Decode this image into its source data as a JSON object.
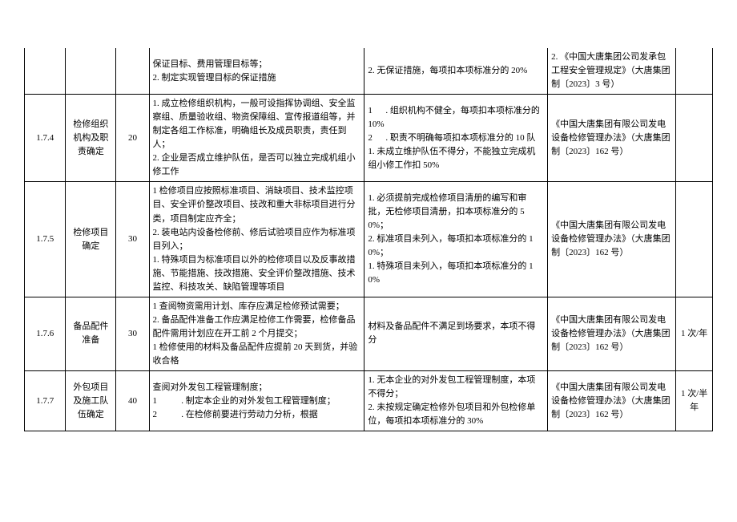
{
  "rows": [
    {
      "id": "",
      "name": "",
      "score": "",
      "content": "保证目标、费用管理目标等；\n2. 制定实现管理目标的保证措施",
      "rule": "2. 无保证措施，每项扣本项标准分的 20%",
      "ref": "2. 《中国大唐集团公司发承包工程安全管理规定》（大唐集团制〔2023〕3 号）",
      "freq": ""
    },
    {
      "id": "1.7.4",
      "name": "检修组织机构及职责确定",
      "score": "20",
      "content": "1. 成立检修组织机构，一般可设指挥协调组、安全监察组、质量验收组、物资保障组、宣传报道组等，并制定各组工作标准，明确组长及成员职责，责任到人；\n2. 企业是否成立维护队伍，是否可以独立完成机组小修工作",
      "rule": "1      . 组织机构不健全，每项扣本项标准分的 10%\n2      . 职责不明确每项扣本项标准分的 10 队\n1. 未成立维护队伍不得分，不能独立完成机组小修工作扣 50%",
      "ref": "《中国大唐集团有限公司发电设备检修管理办法》（大唐集团制〔2023〕162 号）",
      "freq": ""
    },
    {
      "id": "1.7.5",
      "name": "检修项目确定",
      "score": "30",
      "content": "1 检修项目应按照标准项目、消缺项目、技术监控项目、安全评价整改项目、技改和重大非标项目进行分类，项目制定应齐全；\n2. 装电站内设备检修前、修后试验项目应作为标准项目列入；\n1. 特殊项目为标准项目以外的检修项目以及反事故措施、节能措施、技改措施、安全评价整改措施、技术监控、科技攻关、缺陷管理等项目",
      "rule": "1. 必须提前完成检修项目清册的编写和审批，无检修项目清册，扣本项标准分的 50%；\n2. 标准项目未列入，每项扣本项标准分的 10%；\n1. 特殊项目未列入，每项扣本项标准分的 10%",
      "ref": "《中国大唐集团有限公司发电设备检修管理办法》（大唐集团制〔2023〕162 号）",
      "freq": ""
    },
    {
      "id": "1.7.6",
      "name": "备品配件准备",
      "score": "30",
      "content": "1 查阅物资需用计划、库存应满足检修预试需要；\n2. 备品配件准备工作应满足检修工作需要，检修备品配件需用计划应在开工前 2 个月提交；\n1 检修使用的材料及备品配件应提前 20 天到货，并验收合格",
      "rule": "材料及备品配件不满足到场要求，本项不得分",
      "ref": "《中国大唐集团有限公司发电设备检修管理办法》（大唐集团制〔2023〕162 号）",
      "freq": "1 次/年"
    },
    {
      "id": "1.7.7",
      "name": "外包项目及施工队伍确定",
      "score": "40",
      "content": "查阅对外发包工程管理制度；\n1           . 制定本企业的对外发包工程管理制度；\n2           . 在检修前要进行劳动力分析，根据",
      "rule": "1. 无本企业的对外发包工程管理制度，本项不得分；\n2. 未按规定确定检修外包项目和外包检修单位，每项扣本项标准分的 30%",
      "ref": "《中国大唐集团有限公司发电设备检修管理办法》（大唐集团制〔2023〕162 号）",
      "freq": "1 次/半年"
    }
  ]
}
